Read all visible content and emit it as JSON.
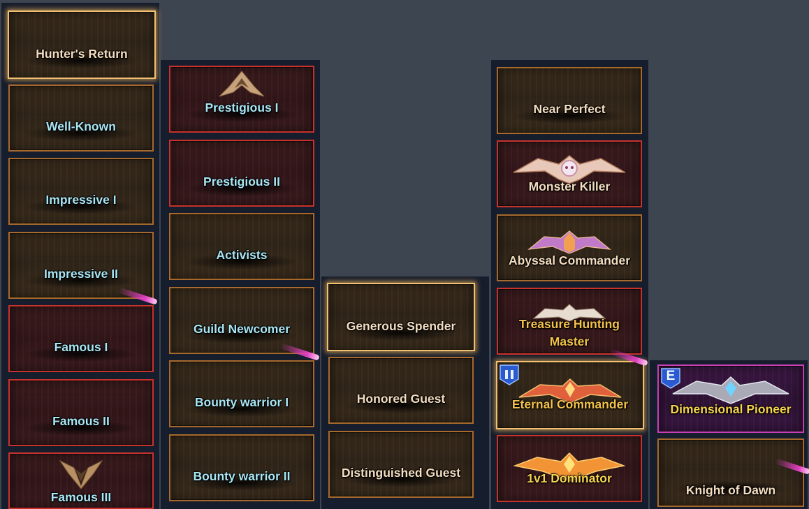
{
  "columns": [
    {
      "tiles": [
        {
          "label": "Hunter's Return",
          "frame": "gold",
          "text_color": "#f4ddc0"
        },
        {
          "label": "Well-Known",
          "frame": "orange",
          "text_color": "#a9e6f4"
        },
        {
          "label": "Impressive I",
          "frame": "orange",
          "text_color": "#a9e6f4"
        },
        {
          "label": "Impressive II",
          "frame": "orange",
          "text_color": "#a9e6f4"
        },
        {
          "label": "Famous I",
          "frame": "red",
          "text_color": "#a9e6f4"
        },
        {
          "label": "Famous II",
          "frame": "red",
          "text_color": "#a9e6f4"
        },
        {
          "label": "Famous III",
          "frame": "red",
          "text_color": "#a9e6f4",
          "emblem": "v-wing-emblem"
        }
      ]
    },
    {
      "tiles": [
        {
          "label": "Prestigious I",
          "frame": "red",
          "text_color": "#a9e6f4",
          "emblem": "chevron-wing-emblem"
        },
        {
          "label": "Prestigious II",
          "frame": "red",
          "text_color": "#a9e6f4"
        },
        {
          "label": "Activists",
          "frame": "orange",
          "text_color": "#a9e6f4"
        },
        {
          "label": "Guild Newcomer",
          "frame": "orange",
          "text_color": "#a9e6f4"
        },
        {
          "label": "Bounty warrior I",
          "frame": "orange",
          "text_color": "#a9e6f4"
        },
        {
          "label": "Bounty warrior II",
          "frame": "orange",
          "text_color": "#a9e6f4"
        }
      ]
    },
    {
      "tiles": [
        {
          "label": "Generous Spender",
          "frame": "gold",
          "text_color": "#f4ddc0"
        },
        {
          "label": "Honored Guest",
          "frame": "orange",
          "text_color": "#f4ddc0"
        },
        {
          "label": "Distinguished Guest",
          "frame": "orange",
          "text_color": "#f4ddc0"
        }
      ]
    },
    {
      "tiles": [
        {
          "label": "Near Perfect",
          "frame": "orange",
          "text_color": "#f4ddc0"
        },
        {
          "label": "Monster Killer",
          "frame": "red",
          "text_color": "#f4ddc0",
          "emblem": "silver-wing-skull-emblem"
        },
        {
          "label": "Abyssal Commander",
          "frame": "orange",
          "text_color": "#f4ddc0",
          "emblem": "purple-helm-wing-emblem"
        },
        {
          "label_line1": "Treasure Hunting",
          "label_line2": "Master",
          "frame": "red",
          "text_color": "#f4c24a",
          "emblem": "treasure-crest-emblem"
        },
        {
          "label": "Eternal Commander",
          "frame": "gold",
          "text_color": "#f4c24a",
          "emblem": "crimson-wing-emblem",
          "badge": "shield-badge-icon"
        },
        {
          "label": "1v1 Dominator",
          "frame": "red",
          "text_color": "#f7d24e",
          "emblem": "flame-wing-emblem"
        }
      ]
    },
    {
      "tiles": [
        {
          "label": "Dimensional Pioneer",
          "frame": "purple",
          "text_color": "#f7d24e",
          "emblem": "steel-wing-emblem",
          "badge_letter": "E"
        },
        {
          "label": "Knight of Dawn",
          "frame": "orange",
          "text_color": "#f4ddc0"
        }
      ]
    }
  ]
}
